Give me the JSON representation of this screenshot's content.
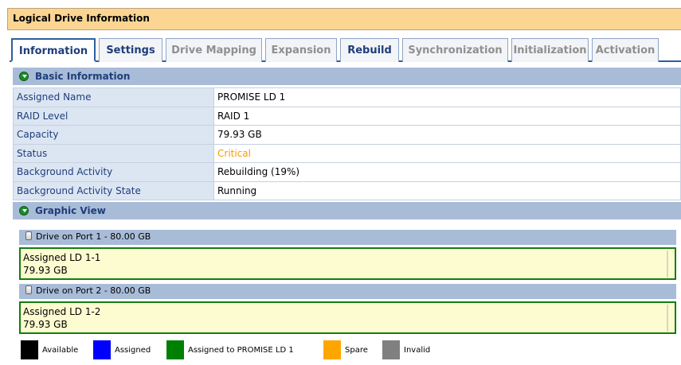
{
  "title": "Logical Drive Information",
  "tabs": [
    {
      "label": "Information",
      "state": "active"
    },
    {
      "label": "Settings",
      "state": "enabled"
    },
    {
      "label": "Drive Mapping",
      "state": "disabled"
    },
    {
      "label": "Expansion",
      "state": "disabled"
    },
    {
      "label": "Rebuild",
      "state": "enabled"
    },
    {
      "label": "Synchronization",
      "state": "disabled"
    },
    {
      "label": "Initialization",
      "state": "disabled"
    },
    {
      "label": "Activation",
      "state": "disabled"
    }
  ],
  "basic_info": {
    "header": "Basic Information",
    "rows": [
      {
        "label": "Assigned Name",
        "value": "PROMISE LD 1"
      },
      {
        "label": "RAID Level",
        "value": "RAID 1"
      },
      {
        "label": "Capacity",
        "value": "79.93 GB"
      },
      {
        "label": "Status",
        "value": "Critical"
      },
      {
        "label": "Background Activity",
        "value": "Rebuilding (19%)"
      },
      {
        "label": "Background Activity State",
        "value": "Running"
      }
    ]
  },
  "graphic_view": {
    "header": "Graphic View",
    "drives": [
      {
        "title": "Drive on Port 1 - 80.00 GB",
        "ld_name": "Assigned LD 1-1",
        "ld_size": "79.93 GB"
      },
      {
        "title": "Drive on Port 2 - 80.00 GB",
        "ld_name": "Assigned LD 1-2",
        "ld_size": "79.93 GB"
      }
    ]
  },
  "legend": [
    {
      "label": "Available",
      "color": "#000000"
    },
    {
      "label": "Assigned",
      "color": "#0000ff"
    },
    {
      "label": "Assigned to PROMISE LD 1",
      "color": "#008000"
    },
    {
      "label": "Spare",
      "color": "#ffa500"
    },
    {
      "label": "Invalid",
      "color": "#808080"
    }
  ],
  "colors": {
    "status_critical": "#f0a000",
    "title_bar": "#fcd593",
    "section_header": "#a8bcd8",
    "ld_border": "#137d13",
    "ld_fill": "#fdfcd0"
  }
}
